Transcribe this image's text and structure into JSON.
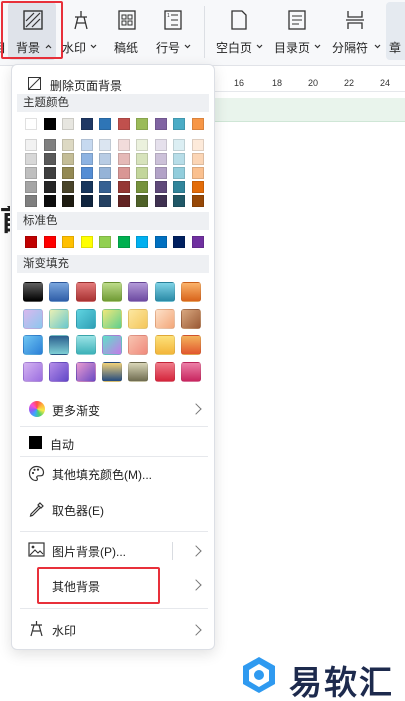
{
  "ribbon": {
    "items": [
      {
        "label": "背景",
        "icon": "background-icon",
        "caret": "up"
      },
      {
        "label": "水印",
        "icon": "watermark-icon",
        "caret": "down"
      },
      {
        "label": "稿纸",
        "icon": "manuscript-icon"
      },
      {
        "label": "行号",
        "icon": "line-number-icon",
        "caret": "down"
      },
      {
        "label": "空白页",
        "icon": "blank-page-icon",
        "caret": "down"
      },
      {
        "label": "目录页",
        "icon": "toc-page-icon",
        "caret": "down"
      },
      {
        "label": "分隔符",
        "icon": "separator-icon",
        "caret": "down"
      },
      {
        "label": "章",
        "icon": "chapter-icon"
      }
    ],
    "cut_left_label": "目"
  },
  "ruler": {
    "ticks": [
      "16",
      "18",
      "20",
      "22",
      "24"
    ]
  },
  "document": {
    "glyph": "首"
  },
  "menu": {
    "delete_bg": "删除页面背景",
    "theme_colors_title": "主题颜色",
    "theme_top_row": [
      "#ffffff",
      "#000000",
      "#e7e6e0",
      "#1f3864",
      "#2e75b6",
      "#c0504d",
      "#9bbb59",
      "#8064a2",
      "#4bacc6",
      "#f79646"
    ],
    "theme_shades": [
      [
        "#f2f2f2",
        "#7f7f7f",
        "#ddd9c3",
        "#c6d9f0",
        "#dbe5f1",
        "#f2dcdb",
        "#ebf1dd",
        "#e5e0ec",
        "#dbeef3",
        "#fdeada"
      ],
      [
        "#d8d8d8",
        "#595959",
        "#c4bd97",
        "#8db3e2",
        "#b8cce4",
        "#e5b9b7",
        "#d7e3bc",
        "#ccc1d9",
        "#b7dde8",
        "#fbd5b5"
      ],
      [
        "#bfbfbf",
        "#3f3f3f",
        "#938953",
        "#548dd4",
        "#95b3d7",
        "#d99694",
        "#c3d69b",
        "#b2a2c7",
        "#92cddc",
        "#fac08f"
      ],
      [
        "#a5a5a5",
        "#262626",
        "#494429",
        "#17365d",
        "#366092",
        "#953734",
        "#76923c",
        "#5f497a",
        "#31859b",
        "#e36c09"
      ],
      [
        "#7f7f7f",
        "#0c0c0c",
        "#1d1b10",
        "#0f243e",
        "#244061",
        "#632423",
        "#4f6128",
        "#3f3151",
        "#205867",
        "#974806"
      ]
    ],
    "standard_title": "标准色",
    "standard_colors": [
      "#c00000",
      "#ff0000",
      "#ffc000",
      "#ffff00",
      "#92d050",
      "#00b050",
      "#00b0f0",
      "#0070c0",
      "#002060",
      "#7030a0"
    ],
    "gradient_title": "渐变填充",
    "gradients": [
      [
        "linear-gradient(180deg,#606060,#000000)",
        "linear-gradient(180deg,#7aa6dd,#2f5ea8)",
        "linear-gradient(180deg,#e47b7b,#a83232)",
        "linear-gradient(180deg,#bedc8a,#6f9a34)",
        "linear-gradient(180deg,#b39ad8,#6d4aa1)",
        "linear-gradient(180deg,#7fd3e6,#2a8aa6)",
        "linear-gradient(180deg,#fbb36b,#d8641b)"
      ],
      [
        "linear-gradient(135deg,#d9b8ee,#8cc7ee)",
        "linear-gradient(135deg,#e9f0b4,#67c7ce)",
        "linear-gradient(135deg,#5fd3e0,#2f9fb5)",
        "linear-gradient(135deg,#f0e87a,#5fcf8f)",
        "linear-gradient(135deg,#fce7a1,#f4c65a)",
        "linear-gradient(135deg,#fde0c8,#f3a77a)",
        "linear-gradient(135deg,#d8a77f,#9a5a36)"
      ],
      [
        "linear-gradient(135deg,#6ec6f2,#2b7fd7)",
        "linear-gradient(180deg,#2b5f8e,#7fd0d6)",
        "linear-gradient(180deg,#9be3e6,#3cb1b8)",
        "linear-gradient(135deg,#5ee0c9,#c57ae8)",
        "linear-gradient(135deg,#f7c4b0,#f08a7c)",
        "linear-gradient(180deg,#fde17a,#f3b53a)",
        "linear-gradient(180deg,#f3b35b,#e2572e)"
      ],
      [
        "linear-gradient(135deg,#d4b3f1,#9b6ee0)",
        "linear-gradient(135deg,#b58de8,#6248c8)",
        "linear-gradient(135deg,#e99bd0,#6b4bc4)",
        "linear-gradient(180deg,#f1d27a,#234a7e)",
        "linear-gradient(180deg,#d9d6b8,#6f6c50)",
        "linear-gradient(180deg,#f07b8a,#d4253b)",
        "linear-gradient(180deg,#ec7fa7,#c8265f)"
      ]
    ],
    "more_gradients": "更多渐变",
    "auto": "自动",
    "other_fill": "其他填充颜色(M)...",
    "eyedropper": "取色器(E)",
    "picture_bg": "图片背景(P)...",
    "other_bg": "其他背景",
    "watermark": "水印"
  },
  "highlight_color": "#e8303a",
  "watermark": {
    "text": "易软汇"
  }
}
